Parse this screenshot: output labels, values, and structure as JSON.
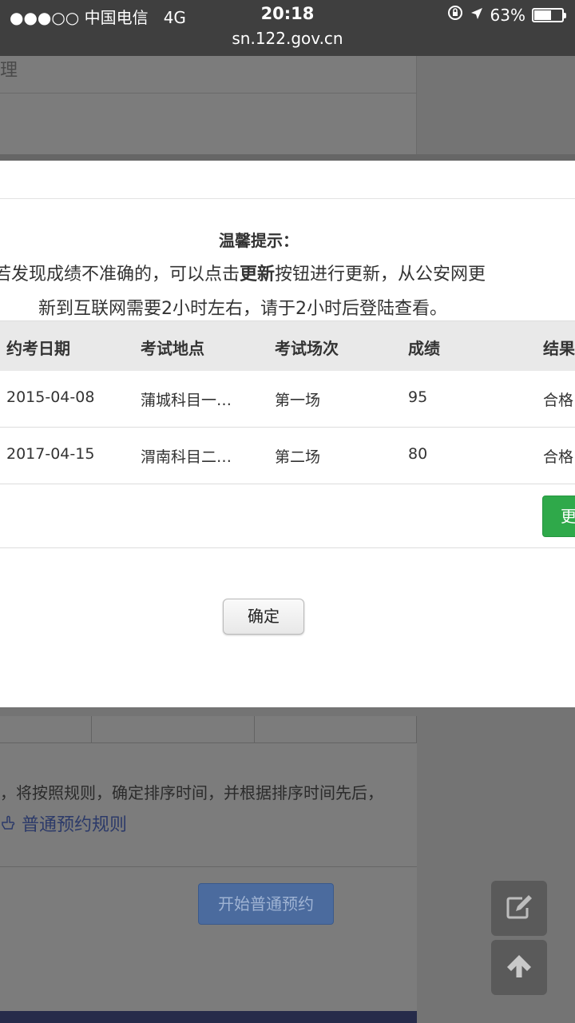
{
  "status_bar": {
    "signal": "●●●○○",
    "carrier": "中国电信",
    "network": "4G",
    "time": "20:18",
    "battery_percent": "63%",
    "battery_level": 0.63,
    "url": "sn.122.gov.cn"
  },
  "background": {
    "partial_text": "理",
    "rule_text": "，将按照规则，确定排序时间，并根据排序时间先后，",
    "rule_link": "普通预约规则",
    "start_button": "开始普通预约"
  },
  "modal": {
    "tip_title": "温馨提示：",
    "tip_line1_a": "若发现成绩不准确的，可以点击",
    "tip_line1_bold": "更新",
    "tip_line1_b": "按钮进行更新，从公安网更",
    "tip_line2": "新到互联网需要2小时左右，请于2小时后登陆查看。",
    "table": {
      "headers": [
        "约考日期",
        "考试地点",
        "考试场次",
        "成绩",
        "结果"
      ],
      "rows": [
        [
          "2015-04-08",
          "蒲城科目一…",
          "第一场",
          "95",
          "合格"
        ],
        [
          "2017-04-15",
          "渭南科目二…",
          "第二场",
          "80",
          "合格"
        ]
      ]
    },
    "update_button": "更新",
    "ok_button": "确定"
  },
  "colors": {
    "status_bar": "#3f3f3f",
    "overlay": "#747474",
    "update_button": "#2fa94a",
    "start_button": "#4b6b9e",
    "link": "#2c3a69"
  },
  "icons": {
    "fab_top": "edit-icon",
    "fab_bottom": "arrow-up-icon",
    "rule_link": "hand-pointer-icon",
    "location": "location-arrow-icon",
    "lock": "orientation-lock-icon"
  }
}
